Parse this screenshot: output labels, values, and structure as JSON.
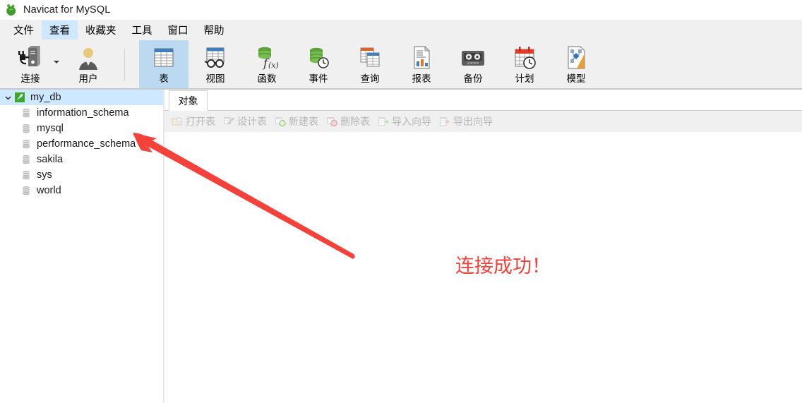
{
  "window": {
    "title": "Navicat for MySQL",
    "logo_icon": "navicat-logo-icon"
  },
  "menubar": {
    "items": [
      {
        "label": "文件",
        "icon": "menu-file"
      },
      {
        "label": "查看",
        "icon": "menu-view",
        "highlighted": true
      },
      {
        "label": "收藏夹",
        "icon": "menu-favorites"
      },
      {
        "label": "工具",
        "icon": "menu-tools"
      },
      {
        "label": "窗口",
        "icon": "menu-window"
      },
      {
        "label": "帮助",
        "icon": "menu-help"
      }
    ]
  },
  "toolbar": {
    "buttons": [
      {
        "label": "连接",
        "icon": "connection-icon",
        "selected": false,
        "has_dropdown": true
      },
      {
        "label": "用户",
        "icon": "user-icon",
        "selected": false
      },
      {
        "label": "表",
        "icon": "table-icon",
        "selected": true
      },
      {
        "label": "视图",
        "icon": "view-icon",
        "selected": false
      },
      {
        "label": "函数",
        "icon": "function-icon",
        "selected": false
      },
      {
        "label": "事件",
        "icon": "event-icon",
        "selected": false
      },
      {
        "label": "查询",
        "icon": "query-icon",
        "selected": false
      },
      {
        "label": "报表",
        "icon": "report-icon",
        "selected": false
      },
      {
        "label": "备份",
        "icon": "backup-icon",
        "selected": false
      },
      {
        "label": "计划",
        "icon": "schedule-icon",
        "selected": false
      },
      {
        "label": "模型",
        "icon": "model-icon",
        "selected": false
      }
    ]
  },
  "sidebar": {
    "root": {
      "label": "my_db",
      "icon": "connection-green-icon",
      "expander": "chevron-down-icon",
      "selected": true
    },
    "databases": [
      {
        "label": "information_schema",
        "icon": "database-icon"
      },
      {
        "label": "mysql",
        "icon": "database-icon"
      },
      {
        "label": "performance_schema",
        "icon": "database-icon"
      },
      {
        "label": "sakila",
        "icon": "database-icon"
      },
      {
        "label": "sys",
        "icon": "database-icon"
      },
      {
        "label": "world",
        "icon": "database-icon"
      }
    ]
  },
  "content": {
    "tabs": [
      {
        "label": "对象",
        "active": true
      }
    ],
    "object_bar": [
      {
        "label": "打开表",
        "icon": "open-table-icon",
        "enabled": false
      },
      {
        "label": "设计表",
        "icon": "design-table-icon",
        "enabled": false
      },
      {
        "label": "新建表",
        "icon": "new-table-icon",
        "enabled": false
      },
      {
        "label": "删除表",
        "icon": "delete-table-icon",
        "enabled": false
      },
      {
        "label": "导入向导",
        "icon": "import-wizard-icon",
        "enabled": false
      },
      {
        "label": "导出向导",
        "icon": "export-wizard-icon",
        "enabled": false
      }
    ]
  },
  "annotation": {
    "note_text": "连接成功！",
    "note_color": "#f4423a",
    "arrow_icon": "red-arrow-icon",
    "arrow_color": "#f4423a"
  }
}
